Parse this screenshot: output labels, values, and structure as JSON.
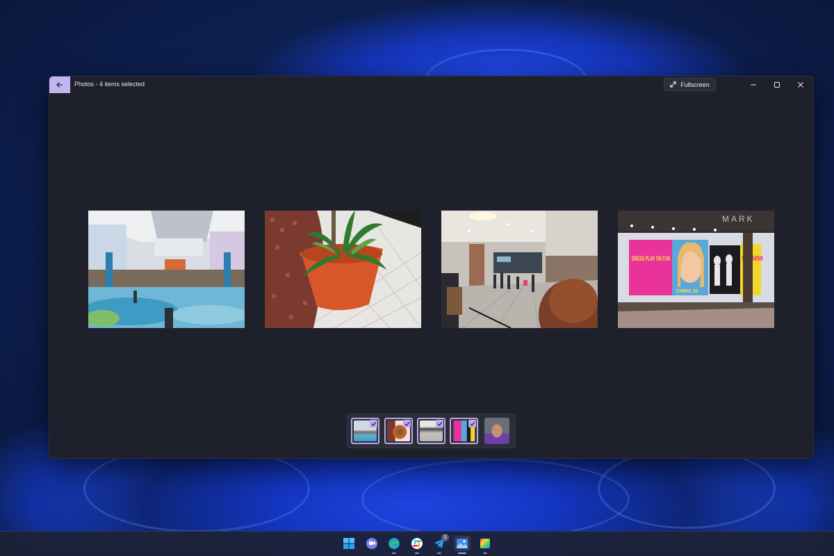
{
  "window": {
    "title": "Photos - 4 items selected",
    "fullscreen_label": "Fullscreen"
  },
  "photos": [
    {
      "name": "mall-atrium",
      "selected": true
    },
    {
      "name": "potted-plant",
      "selected": true
    },
    {
      "name": "mall-corridor-crowd",
      "selected": true
    },
    {
      "name": "store-window-posters",
      "selected": true
    }
  ],
  "poster_text": {
    "left": "DRESS PLAY ON FUN",
    "middle": "CHRIS 20",
    "right": "SUMM"
  },
  "store_sign": "MARK",
  "filmstrip": {
    "items": [
      {
        "name": "mall-atrium",
        "selected": true
      },
      {
        "name": "potted-plant",
        "selected": true
      },
      {
        "name": "mall-corridor-crowd",
        "selected": true
      },
      {
        "name": "store-window-posters",
        "selected": true
      },
      {
        "name": "person-selfie",
        "selected": false
      }
    ]
  },
  "taskbar": {
    "apps": [
      {
        "icon": "windows-start-icon",
        "active": false
      },
      {
        "icon": "teams-chat-icon",
        "active": false
      },
      {
        "icon": "edge-browser-icon",
        "active": false,
        "running": true
      },
      {
        "icon": "slack-icon",
        "active": false,
        "running": true
      },
      {
        "icon": "telegram-icon",
        "active": false,
        "running": true,
        "badge": "3"
      },
      {
        "icon": "photos-app-icon",
        "active": true,
        "running": true
      },
      {
        "icon": "color-app-icon",
        "active": false,
        "running": true
      }
    ]
  },
  "colors": {
    "accent": "#c3b5f0",
    "window_bg": "#1e202b",
    "taskbar_bg": "#1c2234"
  }
}
